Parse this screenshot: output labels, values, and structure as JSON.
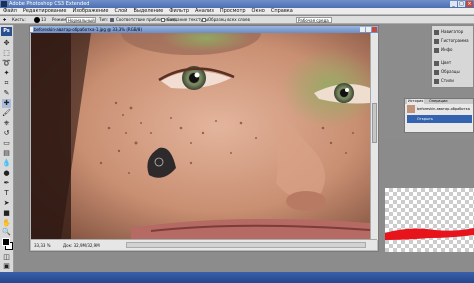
{
  "app": {
    "title": "Adobe Photoshop CS3 Extended",
    "window_buttons": [
      "_",
      "□",
      "×"
    ]
  },
  "menubar": {
    "items": [
      "Файл",
      "Редактирование",
      "Изображение",
      "Слой",
      "Выделение",
      "Фильтр",
      "Анализ",
      "Просмотр",
      "Окно",
      "Справка"
    ]
  },
  "options_bar": {
    "brush_label": "Кисть:",
    "brush_size": "13",
    "mode_label": "Режим:",
    "mode_value": "Нормальный",
    "type_label": "Тип:",
    "option_1": "Соответствие приближения",
    "option_2": "Создание текстуры",
    "option_3": "Образец всех слоев",
    "workspace_label": "Рабочая среда"
  },
  "document": {
    "title": "beforeskin-аватар-обработка-1.jpg @ 33,3% (RGB/8)",
    "zoom": "33,33 %",
    "doc_info": "Док: 32,9M/32,9M"
  },
  "dock": {
    "items": [
      "Навигатор",
      "Гистограмма",
      "Инфо",
      "Цвет",
      "Образцы",
      "Стили"
    ]
  },
  "history_panel": {
    "tabs": [
      "История",
      "Операции"
    ],
    "source": "beforeskin-аватар-обработка",
    "step": "Открыть"
  },
  "colors": {
    "accent": "#3464b0",
    "stroke_red": "#e8141c"
  }
}
